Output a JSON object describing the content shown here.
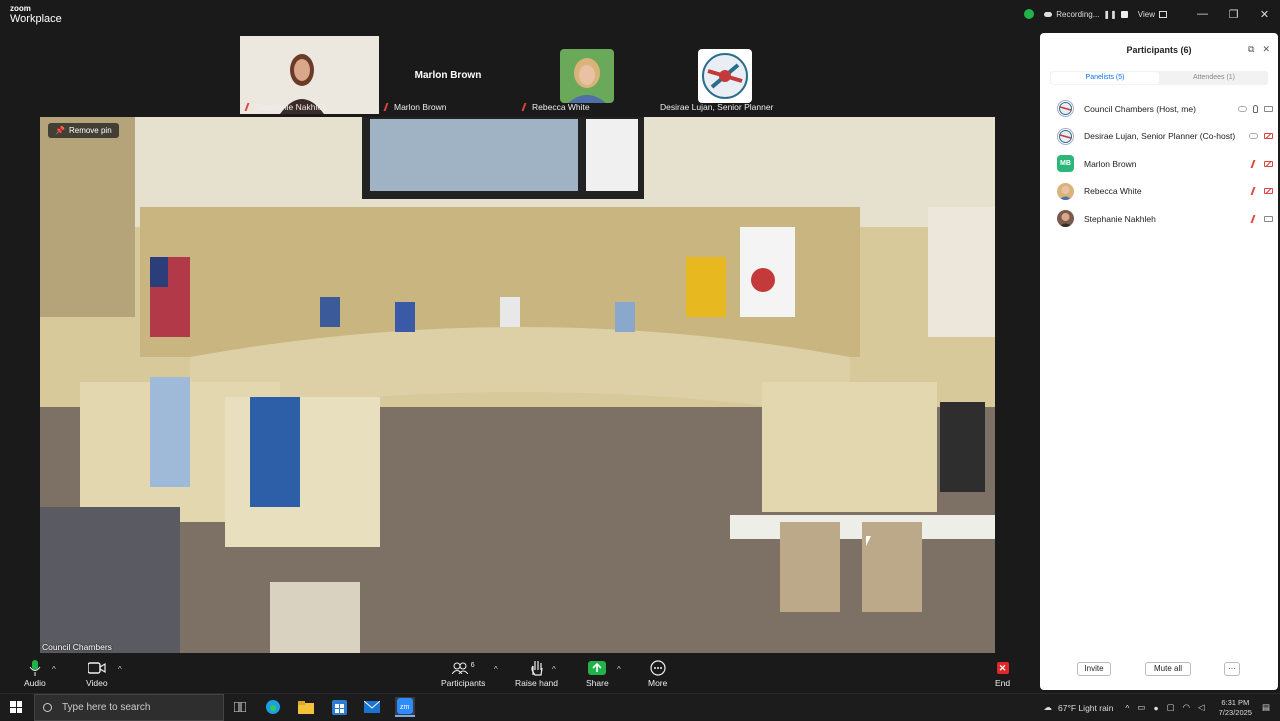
{
  "window": {
    "app_name_top": "zoom",
    "app_name_bottom": "Workplace"
  },
  "titlebar": {
    "recording_label": "Recording...",
    "view_label": "View"
  },
  "thumbnails": [
    {
      "name": "Stephanie Nakhleh",
      "muted": true
    },
    {
      "name": "Marlon Brown",
      "display_name": "Marlon Brown",
      "muted": true
    },
    {
      "name": "Rebecca White",
      "muted": true
    },
    {
      "name": "Desirae Lujan, Senior Planner",
      "muted": false
    }
  ],
  "main_video": {
    "remove_pin_label": "Remove pin",
    "label": "Council Chambers"
  },
  "toolbar": {
    "audio": "Audio",
    "video": "Video",
    "participants": "Participants",
    "participants_count": "6",
    "raise_hand": "Raise hand",
    "share": "Share",
    "more": "More",
    "end": "End"
  },
  "panel": {
    "title": "Participants (6)",
    "tabs": [
      {
        "label": "Panelists (5)",
        "active": true
      },
      {
        "label": "Attendees (1)",
        "active": false
      }
    ],
    "participants": [
      {
        "name": "Council Chambers (Host, me)",
        "avatar": "logo",
        "mic": "on",
        "cam": "on"
      },
      {
        "name": "Desirae Lujan, Senior Planner (Co-host)",
        "avatar": "logo",
        "mic": "none",
        "cam": "off"
      },
      {
        "name": "Marlon Brown",
        "avatar": "MB",
        "mic": "off",
        "cam": "off"
      },
      {
        "name": "Rebecca White",
        "avatar": "photo",
        "mic": "off",
        "cam": "off"
      },
      {
        "name": "Stephanie Nakhleh",
        "avatar": "photo",
        "mic": "off",
        "cam": "on"
      }
    ],
    "invite_label": "Invite",
    "mute_all_label": "Mute all",
    "more_label": "···"
  },
  "taskbar": {
    "search_placeholder": "Type here to search",
    "weather": "67°F  Light rain",
    "time": "6:31 PM",
    "date": "7/23/2025"
  },
  "colors": {
    "accent": "#0e72ed",
    "share_green": "#21b34a",
    "end_red": "#e02828",
    "muted_red": "#e0443e"
  }
}
